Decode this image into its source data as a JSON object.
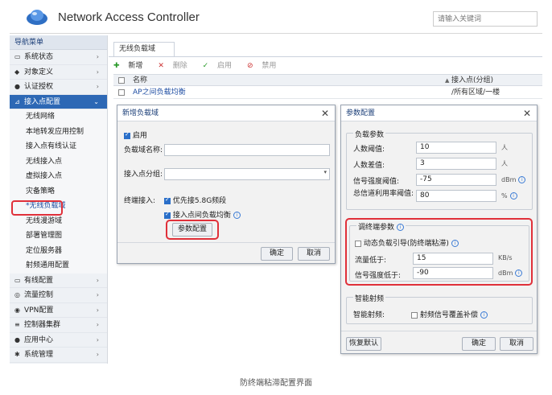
{
  "header": {
    "app_title": "Network Access Controller",
    "search_placeholder": "请输入关键词"
  },
  "sidebar": {
    "title": "导航菜单",
    "items_top": [
      {
        "icon": "monitor-icon",
        "glyph": "▭",
        "label": "系统状态"
      },
      {
        "icon": "shield-icon",
        "glyph": "◆",
        "label": "对象定义"
      },
      {
        "icon": "user-icon",
        "glyph": "●",
        "label": "认证授权"
      },
      {
        "icon": "wifi-icon",
        "glyph": "⊿",
        "label": "接入点配置"
      }
    ],
    "subitems": [
      "无线网络",
      "本地转发应用控制",
      "接入点有线认证",
      "无线接入点",
      "虚拟接入点",
      "灾备策略",
      "*无线负载域",
      "无线漫游域",
      "部署管理图",
      "定位服务器",
      "射频通用配置"
    ],
    "items_bottom": [
      {
        "icon": "wired-icon",
        "glyph": "▭",
        "label": "有线配置"
      },
      {
        "icon": "flow-icon",
        "glyph": "◎",
        "label": "流量控制"
      },
      {
        "icon": "vpn-icon",
        "glyph": "◉",
        "label": "VPN配置"
      },
      {
        "icon": "cluster-icon",
        "glyph": "≡",
        "label": "控制器集群"
      },
      {
        "icon": "app-icon",
        "glyph": "●",
        "label": "应用中心"
      },
      {
        "icon": "gear-icon",
        "glyph": "✱",
        "label": "系统管理"
      }
    ]
  },
  "main": {
    "tab": "无线负载域",
    "toolbar": {
      "add": "新增",
      "delete": "删除",
      "enable": "启用",
      "disable": "禁用"
    },
    "columns": {
      "name": "名称",
      "ap": "接入点(分组)"
    },
    "rows": [
      {
        "name": "AP之间负载均衡",
        "ap": "/所有区域/一楼"
      }
    ]
  },
  "dialog_new": {
    "title": "新增负载域",
    "enable": "启用",
    "name_label": "负载域名称:",
    "group_label": "接入点分组:",
    "terminal_label": "终端接入:",
    "opt_5g": "优先接5.8G频段",
    "opt_balance": "接入点间负载均衡",
    "params_button": "参数配置",
    "ok": "确定",
    "cancel": "取消"
  },
  "dialog_params": {
    "title": "参数配置",
    "load_section": "负载参数",
    "people_threshold_label": "人数阈值:",
    "people_threshold": "10",
    "people_threshold_unit": "人",
    "people_diff_label": "人数差值:",
    "people_diff": "3",
    "people_diff_unit": "人",
    "signal_threshold_label": "信号强度阈值:",
    "signal_threshold": "-75",
    "signal_threshold_unit": "dBm",
    "channel_util_label": "总信道利用率阈值:",
    "channel_util": "80",
    "channel_util_unit": "%",
    "sticky_section": "调终端参数",
    "dynamic_guide": "动态负载引导(防终端粘滞)",
    "traffic_label": "流量低于:",
    "traffic": "15",
    "traffic_unit": "KB/s",
    "signal_low_label": "信号强度低于:",
    "signal_low": "-90",
    "signal_low_unit": "dBm",
    "rf_section": "智能射频",
    "rf_label": "智能射频:",
    "rf_option": "射频信号覆盖补偿",
    "restore": "恢复默认",
    "ok": "确定",
    "cancel": "取消"
  },
  "caption": "防终端粘滞配置界面",
  "colors": {
    "accent": "#2d68b5",
    "highlight": "#e0303a"
  }
}
